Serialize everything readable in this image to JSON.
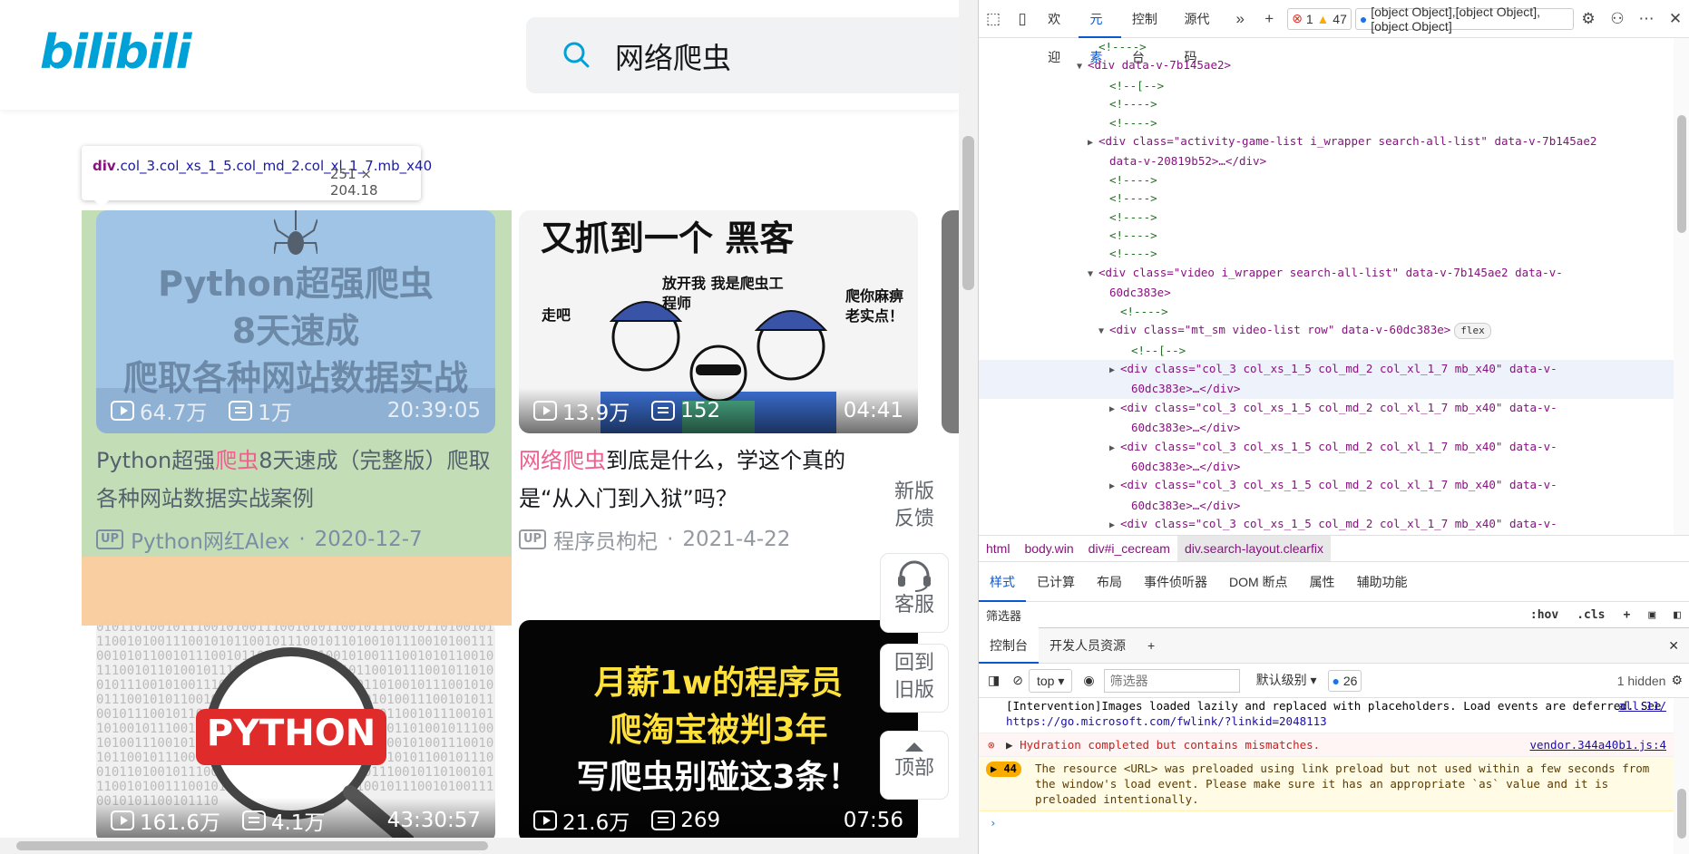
{
  "site": {
    "logo_text": "bilibili",
    "search_query": "网络爬虫"
  },
  "inspect_tooltip": {
    "selector_tag": "div",
    "selector_classes": ".col_3.col_xs_1_5.col_md_2.col_xl_1_7.mb_x40",
    "dimensions": "251 × 204.18"
  },
  "videos": [
    {
      "thumb_lines": [
        "Python超强爬虫",
        "8天速成",
        "爬取各种网站数据实战"
      ],
      "views": "64.7万",
      "danmaku": "1万",
      "duration": "20:39:05",
      "title_pre": "Python超强",
      "title_hl": "爬虫",
      "title_post": "8天速成（完整版）爬取各种网站数据实战案例",
      "uploader": "Python网红Alex",
      "date": "2020-12-7"
    },
    {
      "thumb_lines": [
        "又抓到一个 黑客",
        "放开我 我是爬虫工程师",
        "爬你麻痹 老实点！",
        "走吧"
      ],
      "views": "13.9万",
      "danmaku": "152",
      "duration": "04:41",
      "title_pre": "",
      "title_hl": "网络爬虫",
      "title_post": "到底是什么，学这个真的是“从入门到入狱”吗？",
      "uploader": "程序员枸杞",
      "date": "2021-4-22"
    },
    {
      "thumb_lines": [
        "PYTHON"
      ],
      "views": "161.6万",
      "danmaku": "4.1万",
      "duration": "43:30:57"
    },
    {
      "thumb_lines": [
        "月薪1w的程序员",
        "爬淘宝被判3年",
        "写爬虫别碰这3条！"
      ],
      "views": "21.6万",
      "danmaku": "269",
      "duration": "07:56"
    }
  ],
  "side_buttons": [
    "新版反馈",
    "客服",
    "回到旧版",
    "顶部"
  ],
  "devtools": {
    "toolbar_tabs": [
      "欢迎",
      "元素",
      "控制台",
      "源代码"
    ],
    "active_tab": "元素",
    "errors": "1",
    "warnings": "47",
    "messages": [
      {
        "type": "info",
        "text": "[Intervention]Images loaded lazily and replaced with placeholders. Load events are deferred. See ",
        "link": "https://go.microsoft.com/fwlink/?linkid=2048113",
        "src": "all:11/"
      },
      {
        "type": "error",
        "text": "Hydration completed but contains mismatches.",
        "src": "vendor.344a40b1.js:4"
      },
      {
        "type": "warn",
        "count": "44",
        "text": "The resource <URL> was preloaded using link preload but not used within a few seconds from the window's load event. Please make sure it has an appropriate `as` value and it is preloaded intentionally."
      }
    ],
    "dom_lines": [
      {
        "indent": 10,
        "kind": "cmt",
        "text": "<!---->"
      },
      {
        "indent": 9,
        "kind": "open",
        "tri": "▼",
        "text": "<div data-v-7b145ae2>"
      },
      {
        "indent": 11,
        "kind": "cmt",
        "text": "<!--[-->"
      },
      {
        "indent": 11,
        "kind": "cmt",
        "text": "<!---->"
      },
      {
        "indent": 11,
        "kind": "cmt",
        "text": "<!---->"
      },
      {
        "indent": 10,
        "kind": "raw",
        "tri": "▶",
        "text": "<div class=\"activity-game-list i_wrapper search-all-list\" data-v-7b145ae2"
      },
      {
        "indent": 11,
        "kind": "raw",
        "text": "data-v-20819b52>…</div>"
      },
      {
        "indent": 11,
        "kind": "cmt",
        "text": "<!---->"
      },
      {
        "indent": 11,
        "kind": "cmt",
        "text": "<!---->"
      },
      {
        "indent": 11,
        "kind": "cmt",
        "text": "<!---->"
      },
      {
        "indent": 11,
        "kind": "cmt",
        "text": "<!---->"
      },
      {
        "indent": 11,
        "kind": "cmt",
        "text": "<!---->"
      },
      {
        "indent": 10,
        "kind": "raw",
        "tri": "▼",
        "text": "<div class=\"video i_wrapper search-all-list\" data-v-7b145ae2 data-v-"
      },
      {
        "indent": 11,
        "kind": "raw",
        "text": "60dc383e>"
      },
      {
        "indent": 12,
        "kind": "cmt",
        "text": "<!---->"
      },
      {
        "indent": 11,
        "kind": "raw",
        "tri": "▼",
        "text": "<div class=\"mt_sm video-list row\" data-v-60dc383e>",
        "pill": "flex"
      },
      {
        "indent": 13,
        "kind": "cmt",
        "text": "<!--[-->"
      },
      {
        "indent": 12,
        "kind": "raw",
        "tri": "▶",
        "hover": true,
        "text": "<div class=\"col_3 col_xs_1_5 col_md_2 col_xl_1_7 mb_x40\" data-v-"
      },
      {
        "indent": 13,
        "kind": "raw",
        "hover": true,
        "text": "60dc383e>…</div>"
      },
      {
        "indent": 12,
        "kind": "raw",
        "tri": "▶",
        "text": "<div class=\"col_3 col_xs_1_5 col_md_2 col_xl_1_7 mb_x40\" data-v-"
      },
      {
        "indent": 13,
        "kind": "raw",
        "text": "60dc383e>…</div>"
      },
      {
        "indent": 12,
        "kind": "raw",
        "tri": "▶",
        "text": "<div class=\"col_3 col_xs_1_5 col_md_2 col_xl_1_7 mb_x40\" data-v-"
      },
      {
        "indent": 13,
        "kind": "raw",
        "text": "60dc383e>…</div>"
      },
      {
        "indent": 12,
        "kind": "raw",
        "tri": "▶",
        "text": "<div class=\"col_3 col_xs_1_5 col_md_2 col_xl_1_7 mb_x40\" data-v-"
      },
      {
        "indent": 13,
        "kind": "raw",
        "text": "60dc383e>…</div>"
      },
      {
        "indent": 12,
        "kind": "raw",
        "tri": "▶",
        "text": "<div class=\"col_3 col_xs_1_5 col_md_2 col_xl_1_7 mb_x40\" data-v-"
      },
      {
        "indent": 13,
        "kind": "raw",
        "text": "60dc383e>…</div>"
      }
    ],
    "breadcrumbs": [
      "html",
      "body.win",
      "div#i_cecream",
      "div.search-layout.clearfix"
    ],
    "styles_tabs": [
      "样式",
      "已计算",
      "布局",
      "事件侦听器",
      "DOM 断点",
      "属性",
      "辅助功能"
    ],
    "filter_placeholder": "筛选器",
    "filter_options": [
      ":hov",
      ".cls"
    ],
    "drawer_tabs": [
      "控制台",
      "开发人员资源"
    ],
    "console_context": "top",
    "console_filter_placeholder": "筛选器",
    "log_level": "默认级别",
    "console_msg_count": "26",
    "hidden_count": "1 hidden",
    "prompt": "›"
  },
  "colors": {
    "brand": "#00a1d6",
    "highlight": "#f25d8e",
    "active_blue": "#0b57d0"
  }
}
